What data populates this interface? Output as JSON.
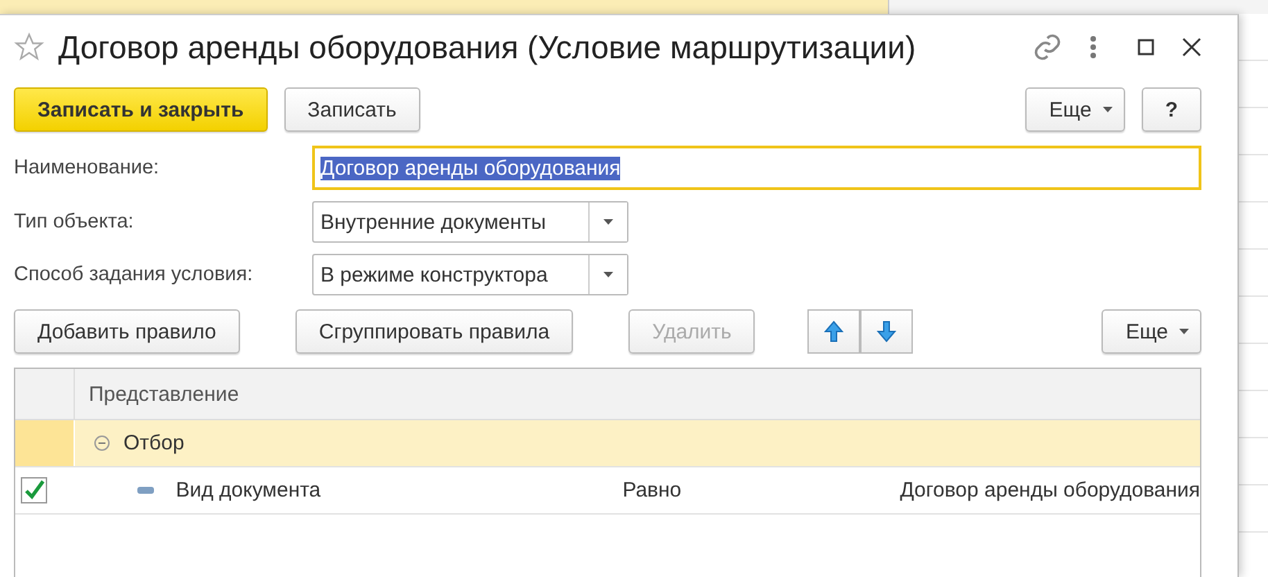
{
  "window": {
    "title": "Договор аренды оборудования (Условие маршрутизации)",
    "favorite": false
  },
  "toolbar": {
    "buttons": [
      {
        "label": "Записать и закрыть",
        "kind": "primary"
      },
      {
        "label": "Записать",
        "kind": "default"
      }
    ],
    "more": "Еще",
    "help": "?"
  },
  "fields": [
    {
      "label": "Наименование:",
      "kind": "text",
      "value": "Договор аренды оборудования",
      "selected": true
    },
    {
      "label": "Тип объекта:",
      "kind": "combo",
      "value": "Внутренние документы"
    },
    {
      "label": "Способ задания условия:",
      "kind": "combo",
      "value": "В режиме конструктора"
    }
  ],
  "rules_toolbar": {
    "buttons": [
      {
        "label": "Добавить правило",
        "disabled": false
      },
      {
        "label": "Сгруппировать правила",
        "disabled": false
      },
      {
        "label": "Удалить",
        "disabled": true
      }
    ],
    "more": "Еще"
  },
  "table": {
    "columns": [
      "Представление"
    ],
    "rows": [
      {
        "kind": "group",
        "label": "Отбор",
        "expanded": true,
        "selected": true,
        "children": [
          {
            "kind": "condition",
            "checked": true,
            "field": "Вид документа",
            "operator": "Равно",
            "value": "Договор аренды оборудования",
            "selected": false
          }
        ]
      }
    ]
  }
}
